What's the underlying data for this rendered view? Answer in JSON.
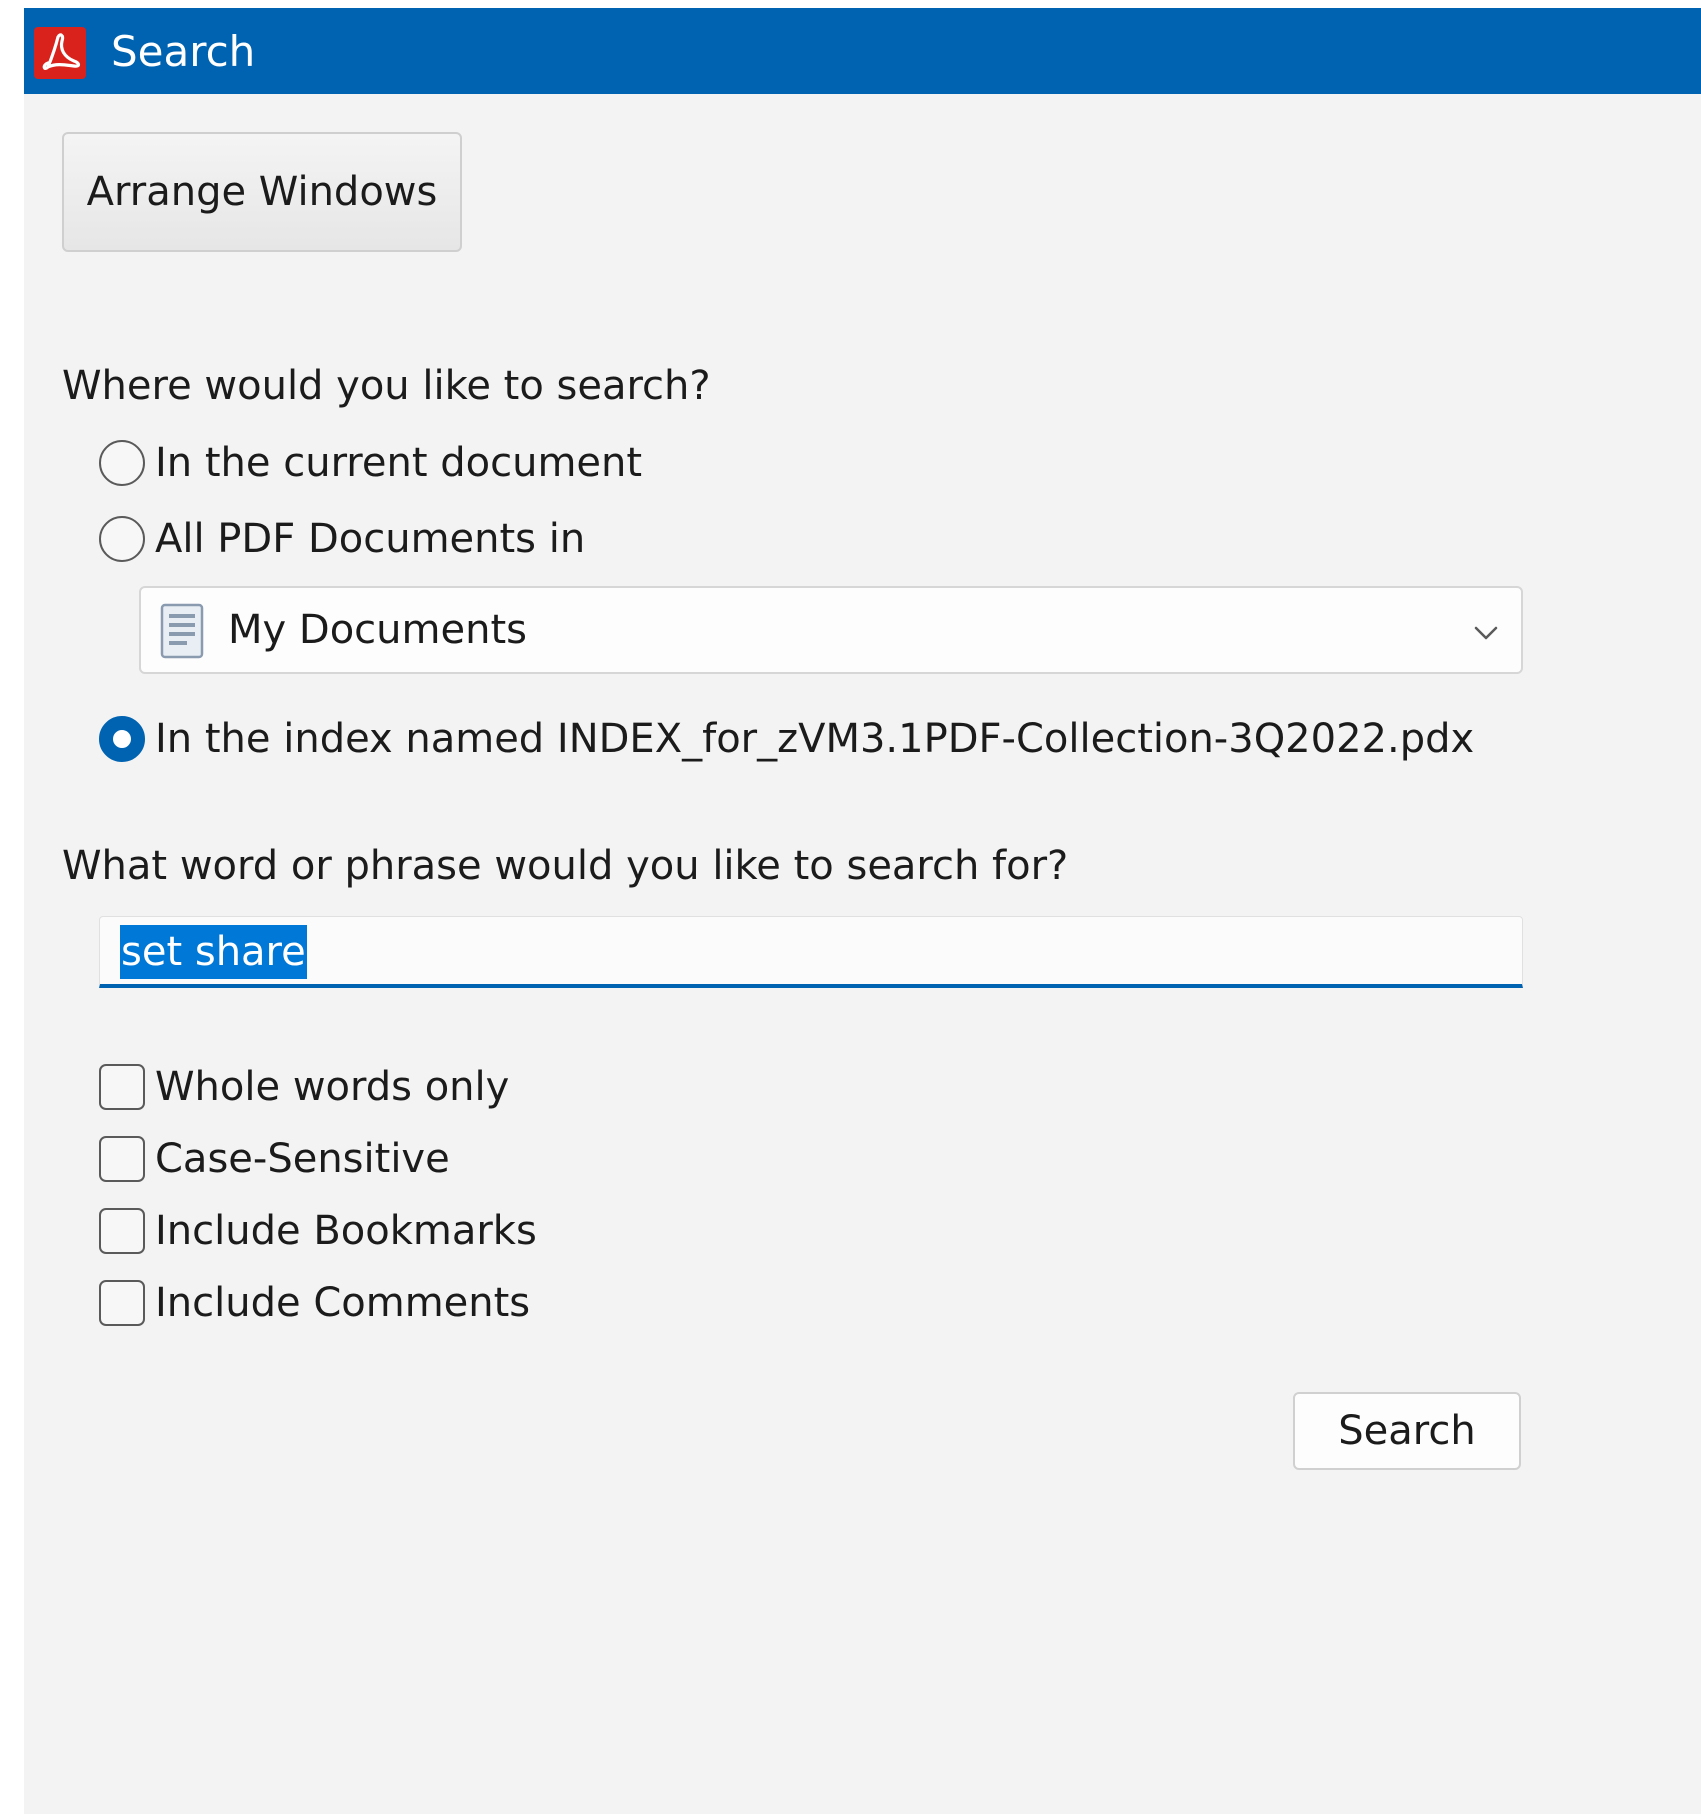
{
  "window": {
    "title": "Search",
    "colors": {
      "titlebar": "#0063b1",
      "accent": "#0078d7",
      "app_icon": "#d9221c"
    }
  },
  "toolbar": {
    "arrange_windows_label": "Arrange Windows"
  },
  "where": {
    "question": "Where would you like to search?",
    "options": [
      {
        "label": "In the current document",
        "checked": false
      },
      {
        "label": "All PDF Documents in",
        "checked": false
      },
      {
        "label": "In the index named INDEX_for_zVM3.1PDF-Collection-3Q2022.pdx",
        "checked": true
      }
    ],
    "location_dropdown": {
      "selected": "My Documents",
      "icon": "document-icon"
    }
  },
  "what": {
    "question": "What word or phrase would you like to search for?",
    "input_value": "set share"
  },
  "checkboxes": [
    {
      "label": "Whole words only",
      "checked": false
    },
    {
      "label": "Case-Sensitive",
      "checked": false
    },
    {
      "label": "Include Bookmarks",
      "checked": false
    },
    {
      "label": "Include Comments",
      "checked": false
    }
  ],
  "actions": {
    "search_label": "Search"
  }
}
